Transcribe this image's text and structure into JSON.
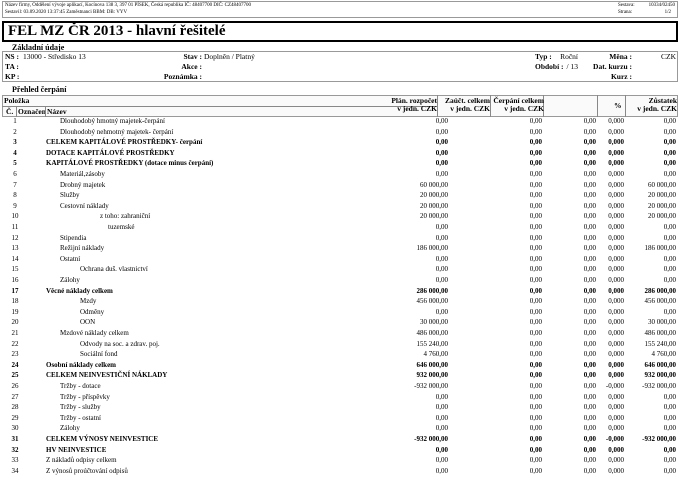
{
  "header": {
    "company": "Název firmy, Oddělení vývoje aplikací, Kocínova 138 3, 397 01 PÍSEK, Česká republika IČ: 48407700 DIČ: CZ48407700",
    "created": "Sestavil: 03.09.2020 13:37:45 Zaměstnanci BBM: DB: VYV",
    "report_label": "Sestava:",
    "report_value": "10334/02450",
    "page_label": "Strana:",
    "page_value": "1/2"
  },
  "title": "FEL MZ ČR 2013 - hlavní řešitelé",
  "basic": {
    "section": "Základní údaje",
    "ns_label": "NS :",
    "ns_value": "13000 - Středisko 13",
    "ta_label": "TA :",
    "kp_label": "KP :",
    "stav_label": "Stav :",
    "stav_value": "Doplněn / Platný",
    "akce_label": "Akce :",
    "poznamka_label": "Poznámka :",
    "typ_label": "Typ :",
    "typ_value": "Roční",
    "obdobi_label": "Období :",
    "obdobi_value": "/ 13",
    "mena_label": "Měna :",
    "mena_value": "CZK",
    "dat_kurzu_label": "Dat. kurzu :",
    "kurz_label": "Kurz :"
  },
  "overview": {
    "section": "Přehled čerpání",
    "polozka": "Položka",
    "col_c": "Č.",
    "col_oznacen": "Označen",
    "col_nazev": "Název",
    "col_plan": [
      "Plán. rozpočet",
      "v jedn. CZK"
    ],
    "col_zauct": [
      "Zaúčt. celkem",
      "v jedn. CZK"
    ],
    "col_cerp": [
      "Čerpání celkem",
      "v jedn. CZK"
    ],
    "col_pct": "%",
    "col_zust": [
      "Zůstatek",
      "v jedn. CZK"
    ]
  },
  "rows": [
    {
      "n": "1",
      "name": "Dlouhodobý hmotný majetek-čerpání",
      "level": 1,
      "bold": false,
      "plan": "0,00",
      "zauct": "0,00",
      "cerp": "0,00",
      "pct": "0,000",
      "zust": "0,00"
    },
    {
      "n": "2",
      "name": "Dlouhodobý nehmotný majetek- čerpání",
      "level": 1,
      "bold": false,
      "plan": "0,00",
      "zauct": "0,00",
      "cerp": "0,00",
      "pct": "0,000",
      "zust": "0,00"
    },
    {
      "n": "3",
      "name": "CELKEM KAPITÁLOVÉ PROSTŘEDKY- čerpání",
      "level": 0,
      "bold": true,
      "plan": "0,00",
      "zauct": "0,00",
      "cerp": "0,00",
      "pct": "0,000",
      "zust": "0,00"
    },
    {
      "n": "4",
      "name": "DOTACE KAPITÁLOVÉ PROSTŘEDKY",
      "level": 0,
      "bold": true,
      "plan": "0,00",
      "zauct": "0,00",
      "cerp": "0,00",
      "pct": "0,000",
      "zust": "0,00"
    },
    {
      "n": "5",
      "name": "KAPITÁLOVÉ PROSTŘEDKY (dotace minus čerpání)",
      "level": 0,
      "bold": true,
      "plan": "0,00",
      "zauct": "0,00",
      "cerp": "0,00",
      "pct": "0,000",
      "zust": "0,00"
    },
    {
      "n": "6",
      "name": "Materiál,zásoby",
      "level": 1,
      "bold": false,
      "plan": "0,00",
      "zauct": "0,00",
      "cerp": "0,00",
      "pct": "0,000",
      "zust": "0,00"
    },
    {
      "n": "7",
      "name": "Drobný majetek",
      "level": 1,
      "bold": false,
      "plan": "60 000,00",
      "zauct": "0,00",
      "cerp": "0,00",
      "pct": "0,000",
      "zust": "60 000,00"
    },
    {
      "n": "8",
      "name": "Služby",
      "level": 1,
      "bold": false,
      "plan": "20 000,00",
      "zauct": "0,00",
      "cerp": "0,00",
      "pct": "0,000",
      "zust": "20 000,00"
    },
    {
      "n": "9",
      "name": "Cestovní náklady",
      "level": 1,
      "bold": false,
      "plan": "20 000,00",
      "zauct": "0,00",
      "cerp": "0,00",
      "pct": "0,000",
      "zust": "20 000,00"
    },
    {
      "n": "10",
      "name": "z toho: zahraniční",
      "level": 3,
      "bold": false,
      "plan": "20 000,00",
      "zauct": "0,00",
      "cerp": "0,00",
      "pct": "0,000",
      "zust": "20 000,00"
    },
    {
      "n": "11",
      "name": "tuzemské",
      "level": 4,
      "bold": false,
      "plan": "0,00",
      "zauct": "0,00",
      "cerp": "0,00",
      "pct": "0,000",
      "zust": "0,00"
    },
    {
      "n": "12",
      "name": "Stipendia",
      "level": 1,
      "bold": false,
      "plan": "0,00",
      "zauct": "0,00",
      "cerp": "0,00",
      "pct": "0,000",
      "zust": "0,00"
    },
    {
      "n": "13",
      "name": "Režijní náklady",
      "level": 1,
      "bold": false,
      "plan": "186 000,00",
      "zauct": "0,00",
      "cerp": "0,00",
      "pct": "0,000",
      "zust": "186 000,00"
    },
    {
      "n": "14",
      "name": "Ostatní",
      "level": 1,
      "bold": false,
      "plan": "0,00",
      "zauct": "0,00",
      "cerp": "0,00",
      "pct": "0,000",
      "zust": "0,00"
    },
    {
      "n": "15",
      "name": "Ochrana duš. vlastnictví",
      "level": 2,
      "bold": false,
      "plan": "0,00",
      "zauct": "0,00",
      "cerp": "0,00",
      "pct": "0,000",
      "zust": "0,00"
    },
    {
      "n": "16",
      "name": "Zálohy",
      "level": 1,
      "bold": false,
      "plan": "0,00",
      "zauct": "0,00",
      "cerp": "0,00",
      "pct": "0,000",
      "zust": "0,00"
    },
    {
      "n": "17",
      "name": "Věcné náklady celkem",
      "level": 0,
      "bold": true,
      "plan": "286 000,00",
      "zauct": "0,00",
      "cerp": "0,00",
      "pct": "0,000",
      "zust": "286 000,00"
    },
    {
      "n": "18",
      "name": "Mzdy",
      "level": 2,
      "bold": false,
      "plan": "456 000,00",
      "zauct": "0,00",
      "cerp": "0,00",
      "pct": "0,000",
      "zust": "456 000,00"
    },
    {
      "n": "19",
      "name": "Odměny",
      "level": 2,
      "bold": false,
      "plan": "0,00",
      "zauct": "0,00",
      "cerp": "0,00",
      "pct": "0,000",
      "zust": "0,00"
    },
    {
      "n": "20",
      "name": "OON",
      "level": 2,
      "bold": false,
      "plan": "30 000,00",
      "zauct": "0,00",
      "cerp": "0,00",
      "pct": "0,000",
      "zust": "30 000,00"
    },
    {
      "n": "21",
      "name": "Mzdové náklady celkem",
      "level": 1,
      "bold": false,
      "plan": "486 000,00",
      "zauct": "0,00",
      "cerp": "0,00",
      "pct": "0,000",
      "zust": "486 000,00"
    },
    {
      "n": "22",
      "name": "Odvody na soc. a zdrav. poj.",
      "level": 2,
      "bold": false,
      "plan": "155 240,00",
      "zauct": "0,00",
      "cerp": "0,00",
      "pct": "0,000",
      "zust": "155 240,00"
    },
    {
      "n": "23",
      "name": "Sociální fond",
      "level": 2,
      "bold": false,
      "plan": "4 760,00",
      "zauct": "0,00",
      "cerp": "0,00",
      "pct": "0,000",
      "zust": "4 760,00"
    },
    {
      "n": "24",
      "name": "Osobní náklady celkem",
      "level": 0,
      "bold": true,
      "plan": "646 000,00",
      "zauct": "0,00",
      "cerp": "0,00",
      "pct": "0,000",
      "zust": "646 000,00"
    },
    {
      "n": "25",
      "name": "CELKEM NEINVESTIČNÍ NÁKLADY",
      "level": 0,
      "bold": true,
      "plan": "932 000,00",
      "zauct": "0,00",
      "cerp": "0,00",
      "pct": "0,000",
      "zust": "932 000,00"
    },
    {
      "n": "26",
      "name": "Tržby - dotace",
      "level": 1,
      "bold": false,
      "plan": "-932 000,00",
      "zauct": "0,00",
      "cerp": "0,00",
      "pct": "-0,000",
      "zust": "-932 000,00"
    },
    {
      "n": "27",
      "name": "Tržby - příspěvky",
      "level": 1,
      "bold": false,
      "plan": "0,00",
      "zauct": "0,00",
      "cerp": "0,00",
      "pct": "0,000",
      "zust": "0,00"
    },
    {
      "n": "28",
      "name": "Tržby - služby",
      "level": 1,
      "bold": false,
      "plan": "0,00",
      "zauct": "0,00",
      "cerp": "0,00",
      "pct": "0,000",
      "zust": "0,00"
    },
    {
      "n": "29",
      "name": "Tržby - ostatní",
      "level": 1,
      "bold": false,
      "plan": "0,00",
      "zauct": "0,00",
      "cerp": "0,00",
      "pct": "0,000",
      "zust": "0,00"
    },
    {
      "n": "30",
      "name": "Zálohy",
      "level": 1,
      "bold": false,
      "plan": "0,00",
      "zauct": "0,00",
      "cerp": "0,00",
      "pct": "0,000",
      "zust": "0,00"
    },
    {
      "n": "31",
      "name": "CELKEM VÝNOSY NEINVESTICE",
      "level": 0,
      "bold": true,
      "plan": "-932 000,00",
      "zauct": "0,00",
      "cerp": "0,00",
      "pct": "-0,000",
      "zust": "-932 000,00"
    },
    {
      "n": "32",
      "name": "HV NEINVESTICE",
      "level": 0,
      "bold": true,
      "plan": "0,00",
      "zauct": "0,00",
      "cerp": "0,00",
      "pct": "0,000",
      "zust": "0,00"
    },
    {
      "n": "33",
      "name": "Z nákladů odpisy celkem",
      "level": 0,
      "bold": false,
      "plan": "0,00",
      "zauct": "0,00",
      "cerp": "0,00",
      "pct": "0,000",
      "zust": "0,00"
    },
    {
      "n": "34",
      "name": "Z výnosů proúčtování odpisů",
      "level": 0,
      "bold": false,
      "plan": "0,00",
      "zauct": "0,00",
      "cerp": "0,00",
      "pct": "0,000",
      "zust": "0,00"
    }
  ]
}
